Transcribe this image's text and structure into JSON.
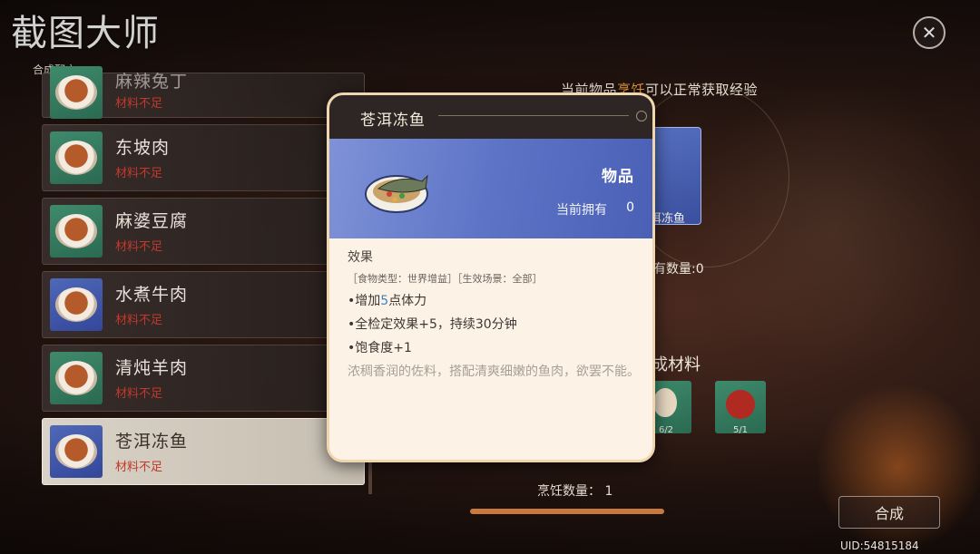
{
  "watermark": "截图大师",
  "section_label": "合成配方",
  "close_icon": "close-icon",
  "recipes": [
    {
      "name": "麻辣兔丁",
      "status": "材料不足"
    },
    {
      "name": "东坡肉",
      "status": "材料不足"
    },
    {
      "name": "麻婆豆腐",
      "status": "材料不足"
    },
    {
      "name": "水煮牛肉",
      "status": "材料不足"
    },
    {
      "name": "清炖羊肉",
      "status": "材料不足"
    },
    {
      "name": "苍洱冻鱼",
      "status": "材料不足",
      "selected": true
    }
  ],
  "hint": {
    "before": "当前物品",
    "highlight": "烹饪",
    "after": "可以正常获取经验"
  },
  "preview": {
    "dish_name_partial": "洱冻鱼",
    "own_count_text": "有数量:0"
  },
  "materials": {
    "title_partial": "成材料",
    "items": [
      {
        "icon": "egg-icon",
        "count": "6/2"
      },
      {
        "icon": "sauce-bag-icon",
        "count": "5/1"
      }
    ]
  },
  "cook": {
    "label": "烹饪数量：",
    "count": "1"
  },
  "craft_button": "合成",
  "uid": "UID:54815184",
  "popup": {
    "title": "苍洱冻鱼",
    "type": "物品",
    "owned_label": "当前拥有",
    "owned_value": "0",
    "effect_title": "效果",
    "tags": "［食物类型：世界增益］［生效场景：全部］",
    "effects": {
      "line1_prefix": "•增加",
      "line1_num": "5",
      "line1_suffix": "点体力",
      "line2": "•全检定效果+5，持续30分钟",
      "line3": "•饱食度+1"
    },
    "flavor": "浓稠香润的佐料，搭配清爽细嫩的鱼肉，欲罢不能。"
  },
  "colors": {
    "accent": "#e39a3b",
    "status_red": "#c0392b",
    "banner_blue": "#5d74c6",
    "number_blue": "#3c84c8"
  }
}
